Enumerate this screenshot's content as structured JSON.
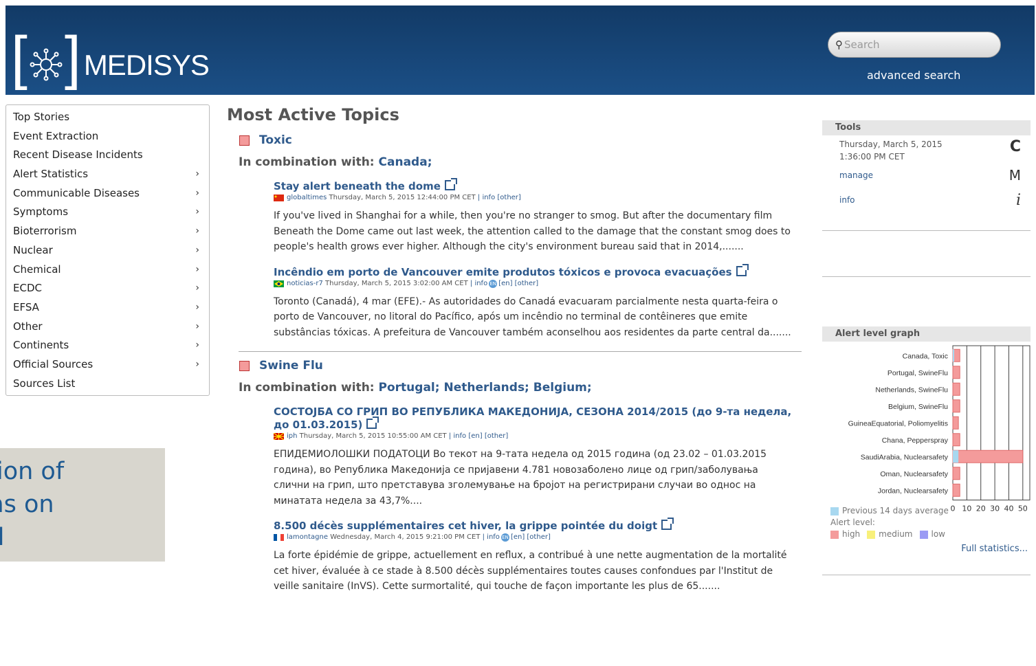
{
  "header": {
    "logo_text": "MEDISYS",
    "search_placeholder": "Search",
    "advanced_search": "advanced search"
  },
  "sidebar": {
    "items": [
      {
        "label": "Top Stories",
        "has_submenu": false
      },
      {
        "label": "Event Extraction",
        "has_submenu": false
      },
      {
        "label": "Recent Disease Incidents",
        "has_submenu": false
      },
      {
        "label": "Alert Statistics",
        "has_submenu": true
      },
      {
        "label": "Communicable Diseases",
        "has_submenu": true
      },
      {
        "label": "Symptoms",
        "has_submenu": true
      },
      {
        "label": "Bioterrorism",
        "has_submenu": true
      },
      {
        "label": "Nuclear",
        "has_submenu": true
      },
      {
        "label": "Chemical",
        "has_submenu": true
      },
      {
        "label": "ECDC",
        "has_submenu": true
      },
      {
        "label": "EFSA",
        "has_submenu": true
      },
      {
        "label": "Other",
        "has_submenu": true
      },
      {
        "label": "Continents",
        "has_submenu": true
      },
      {
        "label": "Official Sources",
        "has_submenu": true
      },
      {
        "label": "Sources List",
        "has_submenu": false
      }
    ],
    "arrow": "›"
  },
  "promo": {
    "text": "ction of\nons on\nud"
  },
  "main": {
    "title": "Most Active Topics",
    "topics": [
      {
        "name": "Toxic",
        "combination_label": "In combination with:",
        "combination_values": "Canada;",
        "articles": [
          {
            "title": "Stay alert beneath the dome",
            "source": "globaltimes",
            "date": "Thursday, March 5, 2015 12:44:00 PM CET",
            "meta_links": "| info [other]",
            "body": "If you've lived in Shanghai for a while, then you're no stranger to smog. But after the documentary film Beneath the Dome came out last week, the attention called to the damage that the constant smog does to people's health grows ever higher. Although the city's environment bureau said that in 2014,.......",
            "flag": "china"
          },
          {
            "title": "Incêndio em porto de Vancouver emite produtos tóxicos e provoca evacuações",
            "source": "noticias-r7",
            "date": "Thursday, March 5, 2015 3:02:00 AM CET",
            "meta_links_pre": "| info",
            "meta_links_post": "[en] [other]",
            "en_badge": "EN",
            "body": "Toronto (Canadá), 4 mar (EFE).- As autoridades do Canadá evacuaram parcialmente nesta quarta-feira o porto de Vancouver, no litoral do Pacífico, após um incêndio no terminal de contêineres que emite substâncias tóxicas. A prefeitura de Vancouver também aconselhou aos residentes da parte central da.......",
            "flag": "brazil"
          }
        ]
      },
      {
        "name": "Swine Flu",
        "combination_label": "In combination with:",
        "combination_values": "Portugal; Netherlands; Belgium;",
        "articles": [
          {
            "title": "СОСТОЈБА СО ГРИП ВО РЕПУБЛИКА МАКЕДОНИЈА, СЕЗОНА 2014/2015 (до 9-та недела, до 01.03.2015)",
            "source": "iph",
            "date": "Thursday, March 5, 2015 10:55:00 AM CET",
            "meta_links": "| info [en] [other]",
            "body": "ЕПИДЕМИОЛОШКИ ПОДАТОЦИ Во текот на 9-тата недела од 2015 година (од 23.02 – 01.03.2015 година), во Република Македонија се пријавени 4.781 новозаболено лице од грип/заболувања слични на грип, што претставува зголемување на бројот на регистрирани случаи во однос на минатата недела за 43,7%....",
            "flag": "macedonia"
          },
          {
            "title": "8.500 décès supplémentaires cet hiver, la grippe pointée du doigt",
            "source": "lamontagne",
            "date": "Wednesday, March 4, 2015 9:21:00 PM CET",
            "meta_links_pre": "| info",
            "meta_links_post": "[en] [other]",
            "en_badge": "EN",
            "body": "La forte épidémie de grippe, actuellement en reflux, a contribué à une nette augmentation de la mortalité cet hiver, évaluée à ce stade à 8.500 décès supplémentaires toutes causes confondues par l'Institut de veille sanitaire (InVS). Cette surmortalité, qui touche de façon importante les plus de 65.......",
            "flag": "france"
          }
        ]
      }
    ]
  },
  "tools": {
    "header": "Tools",
    "date_line1": "Thursday, March 5, 2015",
    "date_line2": "1:36:00 PM CET",
    "manage": "manage",
    "info": "info",
    "refresh_icon": "C",
    "mail_icon": "M",
    "info_icon": "i"
  },
  "alert": {
    "header": "Alert level graph",
    "legend_previous": "Previous 14 days average",
    "legend_alert_level": "Alert level:",
    "legend_high": "high",
    "legend_medium": "medium",
    "legend_low": "low",
    "full_statistics": "Full statistics...",
    "colors": {
      "high": "#f49b9b",
      "medium": "#f8f07a",
      "low": "#9b9bf4",
      "previous": "#a8d8f0"
    }
  },
  "chart_data": {
    "type": "bar",
    "orientation": "horizontal",
    "categories": [
      "Canada, Toxic",
      "Portugal, SwineFlu",
      "Netherlands, SwineFlu",
      "Belgium, SwineFlu",
      "GuineaEquatorial, Poliomyelitis",
      "Chana, Pepperspray",
      "SaudiArabia, Nuclearsafety",
      "Oman, Nuclearsafety",
      "Jordan, Nuclearsafety"
    ],
    "series": [
      {
        "name": "Alert level",
        "values": [
          5,
          5,
          5,
          5,
          4,
          5,
          50,
          5,
          5
        ]
      },
      {
        "name": "Previous 14 days average",
        "values": [
          1,
          0,
          0,
          0,
          0,
          0,
          4,
          0,
          0
        ]
      }
    ],
    "xticks": [
      0,
      10,
      20,
      30,
      40,
      50
    ],
    "xlim": [
      0,
      55
    ]
  }
}
